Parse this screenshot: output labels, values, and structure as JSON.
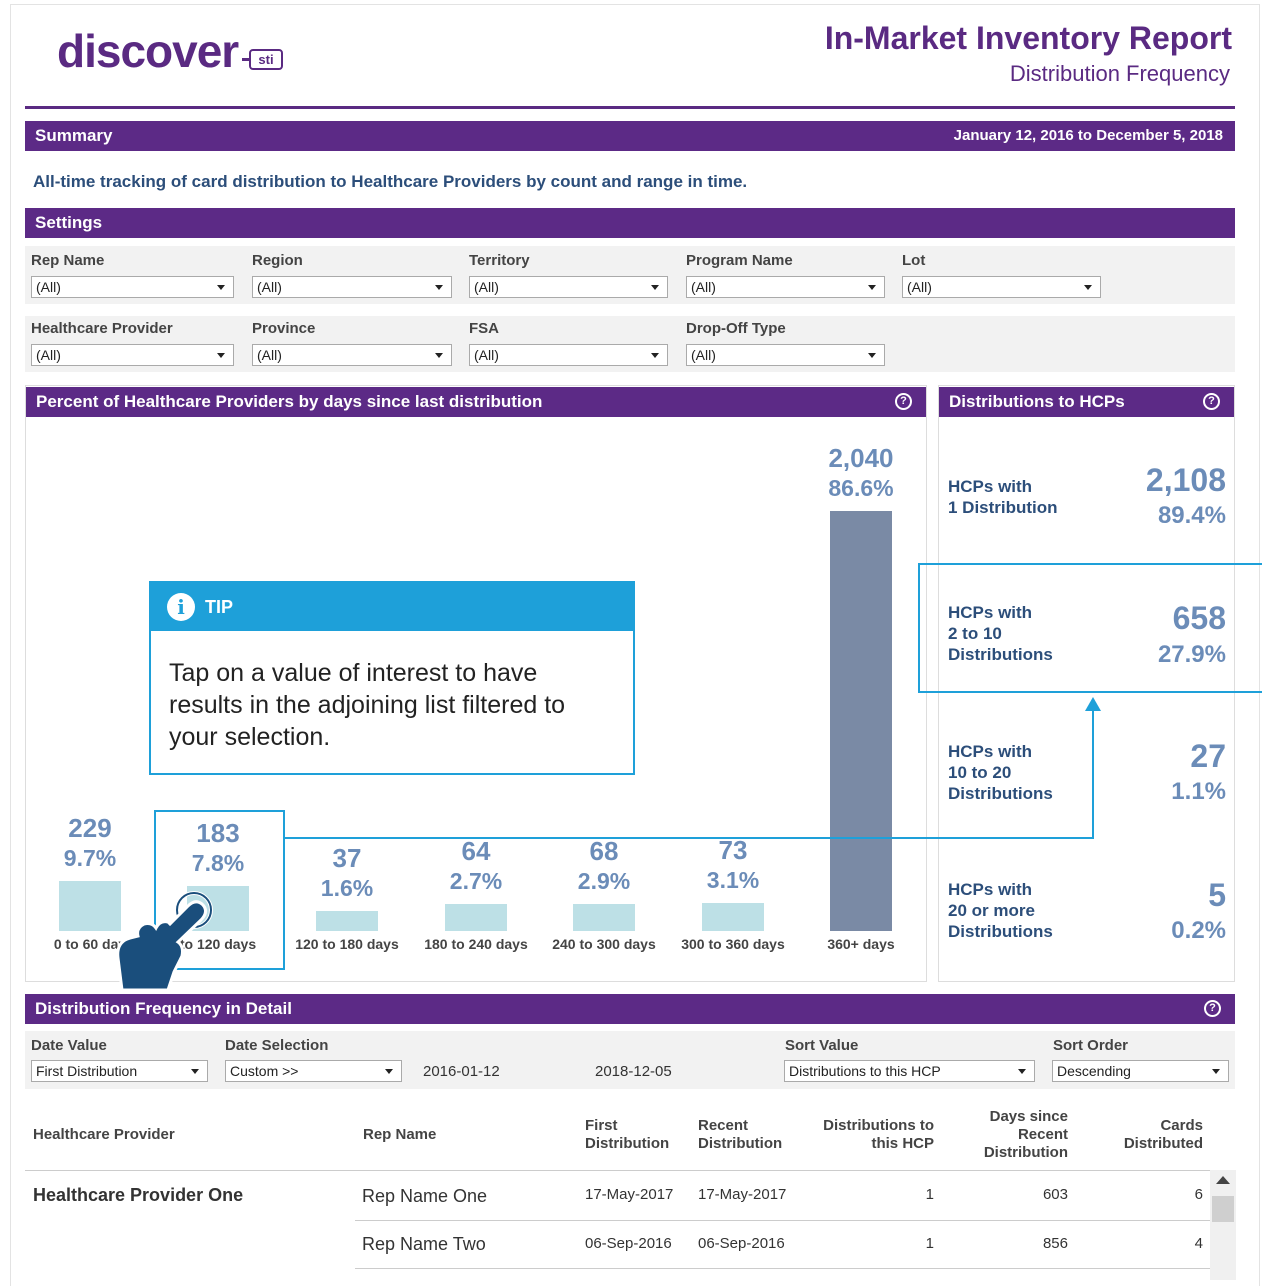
{
  "header": {
    "logo_text": "discover",
    "logo_badge": "sti",
    "title": "In-Market Inventory Report",
    "subtitle": "Distribution Frequency"
  },
  "summary": {
    "label": "Summary",
    "date_range": "January 12, 2016 to December 5, 2018",
    "description": "All-time tracking of card distribution to Healthcare Providers by count and range in time."
  },
  "settings": {
    "label": "Settings",
    "filters": [
      {
        "label": "Rep Name",
        "value": "(All)"
      },
      {
        "label": "Region",
        "value": "(All)"
      },
      {
        "label": "Territory",
        "value": "(All)"
      },
      {
        "label": "Program Name",
        "value": "(All)"
      },
      {
        "label": "Lot",
        "value": "(All)"
      },
      {
        "label": "Healthcare Provider",
        "value": "(All)"
      },
      {
        "label": "Province",
        "value": "(All)"
      },
      {
        "label": "FSA",
        "value": "(All)"
      },
      {
        "label": "Drop-Off Type",
        "value": "(All)"
      }
    ]
  },
  "chart_panel": {
    "title": "Percent of Healthcare Providers by days since last distribution",
    "help_icon": "?"
  },
  "chart_data": {
    "type": "bar",
    "categories": [
      "0 to 60 days",
      "60 to 120 days",
      "120 to 180 days",
      "180 to 240 days",
      "240 to 300 days",
      "300 to 360 days",
      "360+ days"
    ],
    "category_labels_shown": [
      "0 to 60 day",
      "to 120 days",
      "120 to 180 days",
      "180 to 240 days",
      "240 to 300 days",
      "300 to 360 days",
      "360+ days"
    ],
    "values": [
      229,
      183,
      37,
      64,
      68,
      73,
      2040
    ],
    "value_labels": [
      "229",
      "183",
      "37",
      "64",
      "68",
      "73",
      "2,040"
    ],
    "percents": [
      "9.7%",
      "7.8%",
      "1.6%",
      "2.7%",
      "2.9%",
      "3.1%",
      "86.6%"
    ],
    "colors": {
      "normal": "#bde0e6",
      "highlight": "#7a8aa5"
    }
  },
  "hcp_panel": {
    "title": "Distributions to HCPs",
    "help_icon": "?",
    "items": [
      {
        "label": "HCPs with\n1 Distribution",
        "count": "2,108",
        "percent": "89.4%"
      },
      {
        "label": "HCPs with\n2 to 10\nDistributions",
        "count": "658",
        "percent": "27.9%"
      },
      {
        "label": "HCPs with\n10 to 20\nDistributions",
        "count": "27",
        "percent": "1.1%"
      },
      {
        "label": "HCPs with\n20 or more\nDistributions",
        "count": "5",
        "percent": "0.2%"
      }
    ]
  },
  "tip": {
    "label": "TIP",
    "icon": "info-icon",
    "text": "Tap on a value of interest to have results in the adjoining list filtered to your selection."
  },
  "detail": {
    "title": "Distribution Frequency in Detail",
    "help_icon": "?",
    "controls": {
      "date_value_label": "Date Value",
      "date_value": "First Distribution",
      "date_selection_label": "Date Selection",
      "date_selection": "Custom >>",
      "start_date": "2016-01-12",
      "end_date": "2018-12-05",
      "sort_value_label": "Sort Value",
      "sort_value": "Distributions to this HCP",
      "sort_order_label": "Sort Order",
      "sort_order": "Descending"
    },
    "columns": [
      "Healthcare Provider",
      "Rep Name",
      "First\nDistribution",
      "Recent\nDistribution",
      "Distributions to\nthis HCP",
      "Days since\nRecent\nDistribution",
      "Cards\nDistributed"
    ],
    "rows": [
      {
        "provider": "Healthcare Provider One",
        "rep": "Rep Name One",
        "first": "17-May-2017",
        "recent": "17-May-2017",
        "distributions": "1",
        "days": "603",
        "cards": "6"
      },
      {
        "provider": "",
        "rep": "Rep Name Two",
        "first": "06-Sep-2016",
        "recent": "06-Sep-2016",
        "distributions": "1",
        "days": "856",
        "cards": "4"
      }
    ]
  },
  "colors": {
    "brand_purple": "#5c2a86",
    "tip_blue": "#1ea0d9",
    "value_blue": "#6b8cb8",
    "text_navy": "#2c4e7a"
  }
}
